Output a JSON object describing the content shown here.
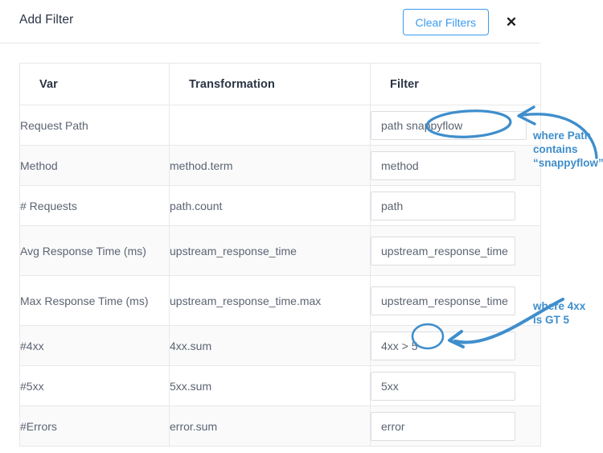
{
  "dialog": {
    "title": "Add Filter",
    "clear_filters_label": "Clear Filters",
    "close_label": "✕"
  },
  "table": {
    "columns": [
      "Var",
      "Transformation",
      "Filter"
    ],
    "rows": [
      {
        "var": "Request Path",
        "transformation": "",
        "filter": "path  snappyflow"
      },
      {
        "var": "Method",
        "transformation": "method.term",
        "filter": "method"
      },
      {
        "var": "# Requests",
        "transformation": "path.count",
        "filter": "path"
      },
      {
        "var": "Avg Response Time\n(ms)",
        "transformation": "upstream_response_time",
        "filter": "upstream_response_time"
      },
      {
        "var": "Max Response Time\n(ms)",
        "transformation": "upstream_response_time.max",
        "filter": "upstream_response_time"
      },
      {
        "var": "#4xx",
        "transformation": "4xx.sum",
        "filter": "4xx > 5"
      },
      {
        "var": "#5xx",
        "transformation": "5xx.sum",
        "filter": "5xx"
      },
      {
        "var": "#Errors",
        "transformation": "error.sum",
        "filter": "error"
      }
    ]
  },
  "annotations": {
    "path_note": "where Path\ncontains\n“snappyflow”",
    "fourxx_note": "where 4xx\nis GT 5",
    "color": "#3f8ecc"
  }
}
